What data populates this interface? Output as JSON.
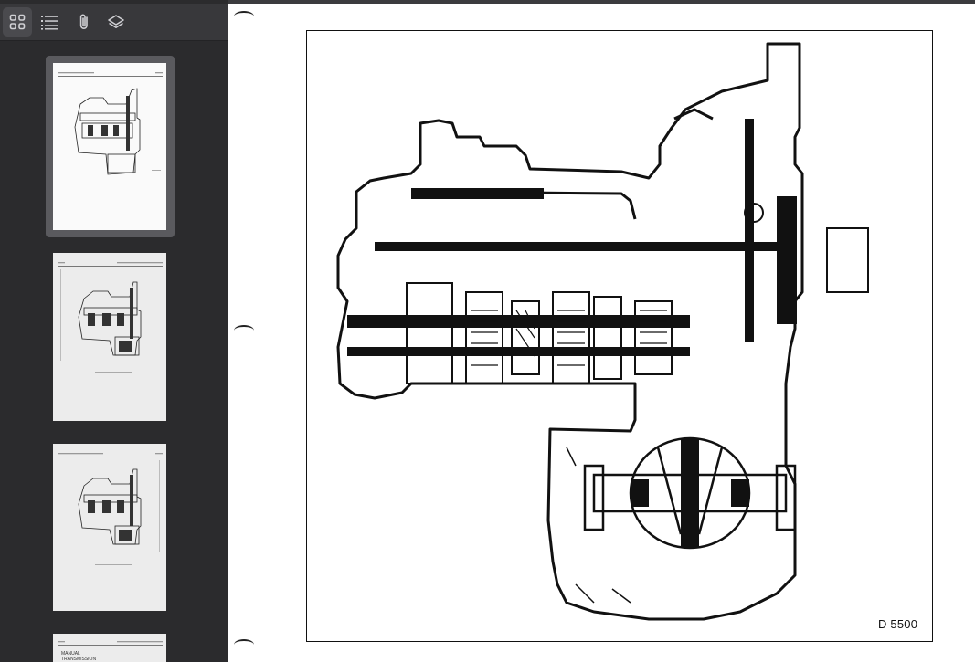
{
  "sidebar": {
    "toolbar": {
      "buttons": [
        {
          "icon": "grid-icon",
          "active": true
        },
        {
          "icon": "list-icon",
          "active": false
        },
        {
          "icon": "paperclip-icon",
          "active": false
        },
        {
          "icon": "layers-icon",
          "active": false
        }
      ]
    },
    "thumbnails": [
      {
        "selected": true
      },
      {
        "selected": false
      },
      {
        "selected": false
      },
      {
        "selected": false,
        "header": "MANUAL TRANSMISSION"
      }
    ]
  },
  "document": {
    "figure_label": "D 5500"
  },
  "colors": {
    "sidebar_bg": "#2b2b2d",
    "toolbar_bg": "#38383b",
    "active_button": "#4a4a4e",
    "icon": "#d0d0d4",
    "page_bg": "#ffffff"
  }
}
